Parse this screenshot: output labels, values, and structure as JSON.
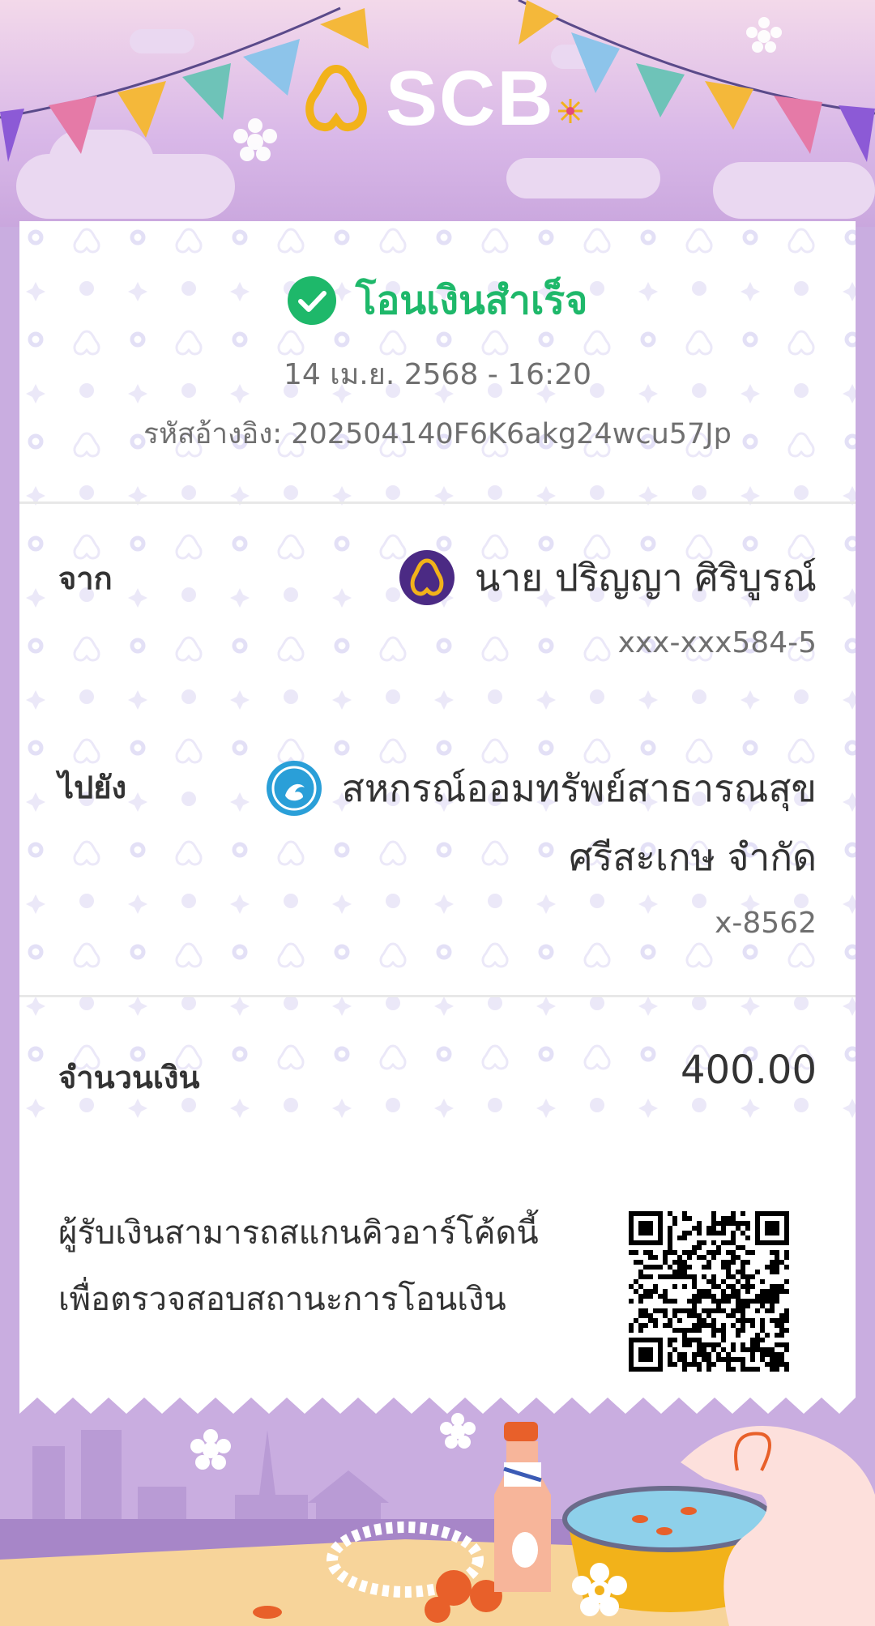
{
  "brand": {
    "name": "SCB",
    "colors": {
      "gold": "#f2b21a",
      "purple": "#4b2a84",
      "white": "#ffffff"
    }
  },
  "status": {
    "icon": "check-circle-icon",
    "title": "โอนเงินสำเร็จ",
    "color": "#1eb86a"
  },
  "datetime": "14 เม.ย. 2568 - 16:20",
  "reference": "รหัสอ้างอิง: 202504140F6K6akg24wcu57Jp",
  "from": {
    "label": "จาก",
    "name": "นาย ปริญญา ศิริบูรณ์",
    "account": "xxx-xxx584-5",
    "bank_icon": "scb-bank-icon"
  },
  "to": {
    "label": "ไปยัง",
    "name_line1": "สหกรณ์ออมทรัพย์สาธารณสุข",
    "name_line2": "ศรีสะเกษ จำกัด",
    "account": "x-8562",
    "bank_icon": "kbank-bank-icon"
  },
  "amount": {
    "label": "จำนวนเงิน",
    "value": "400.00"
  },
  "qr": {
    "line1": "ผู้รับเงินสามารถสแกนคิวอาร์โค้ดนี้",
    "line2": "เพื่อตรวจสอบสถานะการโอนเงิน",
    "icon": "qr-code-icon"
  }
}
